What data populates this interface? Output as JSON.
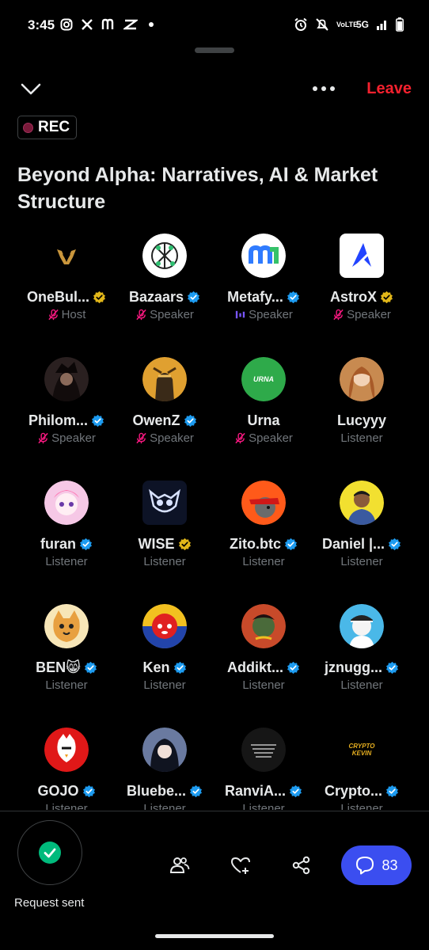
{
  "status_bar": {
    "time": "3:45",
    "left_icons": [
      "instagram-icon",
      "x-icon",
      "m-icon",
      "capcut-icon",
      "dot-icon"
    ],
    "right_icons": [
      "alarm-icon",
      "mute-icon",
      "volte-icon",
      "network-icon",
      "signal-icon",
      "battery-icon"
    ],
    "volte": "VoLTE",
    "network": "5G"
  },
  "header": {
    "leave_label": "Leave",
    "rec_label": "REC",
    "title": "Beyond Alpha: Narratives, AI & Market Structure"
  },
  "participants": [
    {
      "name": "OneBul...",
      "badge": "gold",
      "role": "Host",
      "role_icon": "muted-mic",
      "avatar": "onebull"
    },
    {
      "name": "Bazaars",
      "badge": "blue",
      "role": "Speaker",
      "role_icon": "muted-mic",
      "avatar": "bazaars"
    },
    {
      "name": "Metafy...",
      "badge": "blue",
      "role": "Speaker",
      "role_icon": "speaking",
      "avatar": "metafy"
    },
    {
      "name": "AstroX",
      "badge": "gold",
      "role": "Speaker",
      "role_icon": "muted-mic",
      "avatar": "astrox"
    },
    {
      "name": "Philom...",
      "badge": "blue",
      "role": "Speaker",
      "role_icon": "muted-mic",
      "avatar": "philom"
    },
    {
      "name": "OwenZ",
      "badge": "blue",
      "role": "Speaker",
      "role_icon": "muted-mic",
      "avatar": "owenz"
    },
    {
      "name": "Urna",
      "badge": "none",
      "role": "Speaker",
      "role_icon": "muted-mic",
      "avatar": "urna",
      "avatar_text": "URNA"
    },
    {
      "name": "Lucyyy",
      "badge": "none",
      "role": "Listener",
      "role_icon": "none",
      "avatar": "lucyyy"
    },
    {
      "name": "furan",
      "badge": "blue",
      "role": "Listener",
      "role_icon": "none",
      "avatar": "furan"
    },
    {
      "name": "WISE",
      "badge": "gold",
      "role": "Listener",
      "role_icon": "none",
      "avatar": "wise"
    },
    {
      "name": "Zito.btc",
      "badge": "blue",
      "role": "Listener",
      "role_icon": "none",
      "avatar": "zito"
    },
    {
      "name": "Daniel |...",
      "badge": "blue",
      "role": "Listener",
      "role_icon": "none",
      "avatar": "daniel"
    },
    {
      "name": "BEN😸",
      "badge": "blue",
      "role": "Listener",
      "role_icon": "none",
      "avatar": "ben"
    },
    {
      "name": "Ken",
      "badge": "blue",
      "role": "Listener",
      "role_icon": "none",
      "avatar": "ken"
    },
    {
      "name": "Addikt...",
      "badge": "blue",
      "role": "Listener",
      "role_icon": "none",
      "avatar": "addikt"
    },
    {
      "name": "jznugg...",
      "badge": "blue",
      "role": "Listener",
      "role_icon": "none",
      "avatar": "jznugg"
    },
    {
      "name": "GOJO",
      "badge": "blue",
      "role": "Listener",
      "role_icon": "none",
      "avatar": "gojo"
    },
    {
      "name": "Bluebe...",
      "badge": "blue",
      "role": "Listener",
      "role_icon": "none",
      "avatar": "bluebe"
    },
    {
      "name": "RanviA...",
      "badge": "blue",
      "role": "Listener",
      "role_icon": "none",
      "avatar": "ranvia"
    },
    {
      "name": "Crypto...",
      "badge": "blue",
      "role": "Listener",
      "role_icon": "none",
      "avatar": "crypto",
      "avatar_text": "CRYPTO KEVIN"
    }
  ],
  "bottom_bar": {
    "request_label": "Request sent",
    "chat_count": "83",
    "icons": [
      "people-icon",
      "heart-plus-icon",
      "share-icon",
      "chat-icon"
    ]
  },
  "colors": {
    "background": "#000000",
    "text_primary": "#e7e9ea",
    "text_secondary": "#71767b",
    "leave_red": "#f4212e",
    "verified_blue": "#1d9bf0",
    "verified_gold": "#e2b719",
    "mute_pink": "#f91880",
    "speaking_purple": "#7856ff",
    "chat_button": "#3b4ef0",
    "request_green": "#00ba7c"
  }
}
